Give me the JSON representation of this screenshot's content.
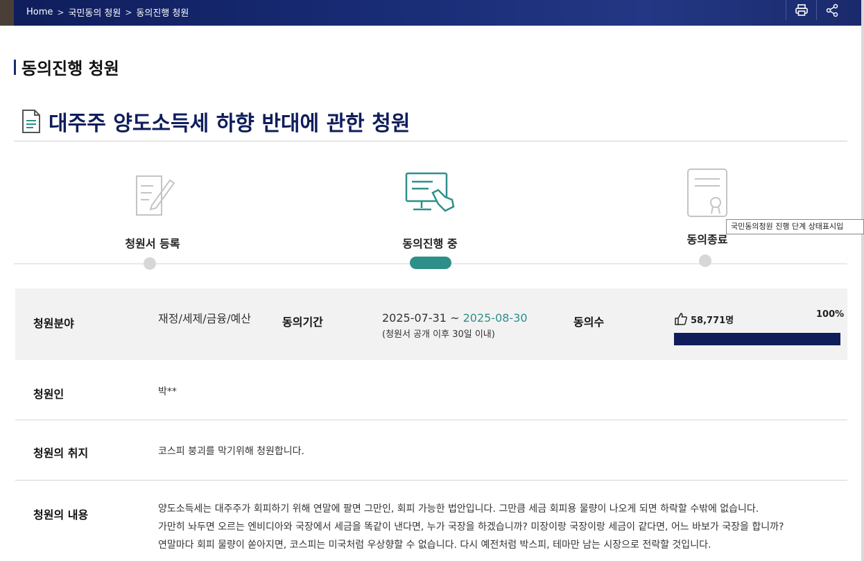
{
  "breadcrumb": {
    "home": "Home",
    "level1": "국민동의 청원",
    "level2": "동의진행 청원",
    "separator": ">"
  },
  "toolbar": {
    "print_icon": "printer-icon",
    "share_icon": "share-icon"
  },
  "section_title": "동의진행 청원",
  "petition": {
    "title": "대주주 양도소득세 하향 반대에 관한 청원",
    "title_icon": "document-icon"
  },
  "steps": [
    {
      "label": "청원서 등록",
      "icon": "pen-paper-icon",
      "status": "done"
    },
    {
      "label": "동의진행 중",
      "icon": "monitor-hand-icon",
      "status": "current"
    },
    {
      "label": "동의종료",
      "icon": "certificate-icon",
      "status": "pending"
    }
  ],
  "tooltip": "국민동의청원 진행 단계 상태표시입",
  "info": {
    "field_label": "청원분야",
    "field_value": "재정/세제/금융/예산",
    "period_label": "동의기간",
    "period_start": "2025-07-31",
    "period_sep": "~",
    "period_end": "2025-08-30",
    "period_note": "(청원서 공개 이후 30일 이내)",
    "count_label": "동의수",
    "count_value": "58,771명",
    "percent": "100%",
    "progress": 1.0
  },
  "petitioner": {
    "label": "청원인",
    "value": "박**"
  },
  "purpose": {
    "label": "청원의 취지",
    "value": "코스피 붕괴를 막기위해 청원합니다."
  },
  "content": {
    "label": "청원의 내용",
    "lines": [
      "양도소득세는 대주주가 회피하기 위해 연말에 팔면 그만인, 회피 가능한 법안입니다. 그만큼 세금 회피용 물량이 나오게 되면 하락할 수밖에 없습니다.",
      "가만히 놔두면 오르는 엔비디아와 국장에서 세금을 똑같이 낸다면, 누가 국장을 하겠습니까? 미장이랑 국장이랑 세금이 같다면, 어느 바보가 국장을 합니까?",
      "연말마다 회피 물량이 쏟아지면, 코스피는 미국처럼 우상향할 수 없습니다. 다시 예전처럼 박스피, 테마만 남는 시장으로 전락할 것입니다."
    ]
  },
  "colors": {
    "navy": "#0f1d5b",
    "teal": "#2d8f8a",
    "gray_dot": "#d7d7d7"
  }
}
